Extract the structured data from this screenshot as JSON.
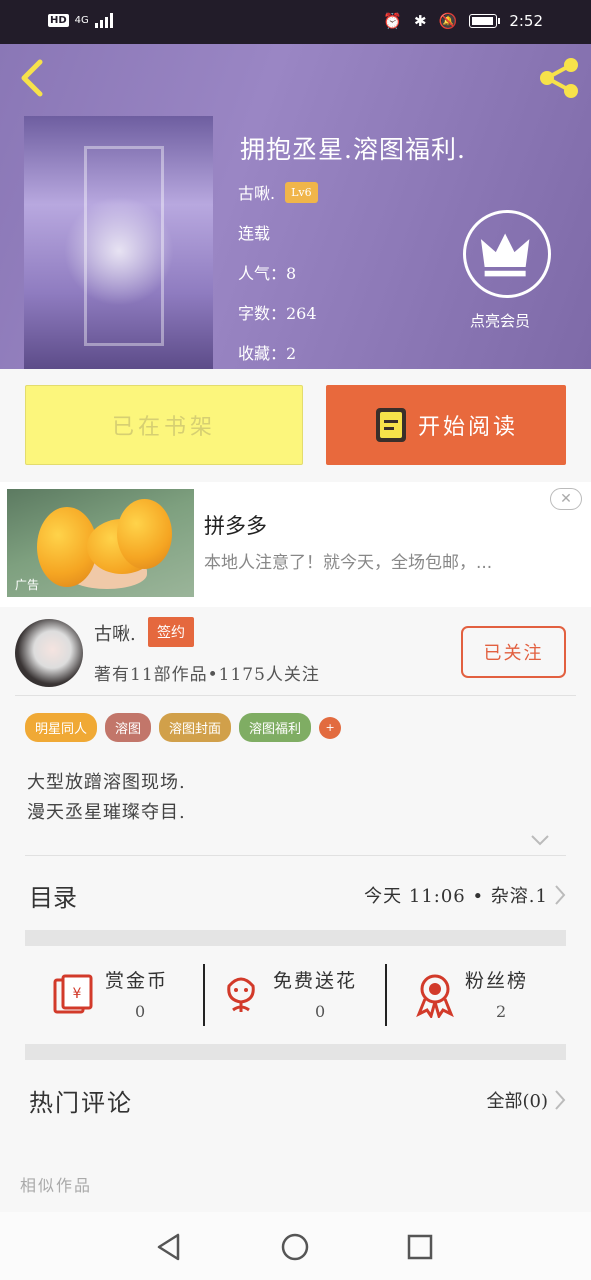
{
  "status_bar": {
    "network_hd": "HD",
    "network_type": "4G",
    "time": "2:52"
  },
  "book": {
    "title": "拥抱丞星.溶图福利.",
    "author": "古啾.",
    "level": "Lv6",
    "status": "连载",
    "popularity": "人气：8",
    "word_count": "字数：264",
    "favorites": "收藏：2",
    "vip_label": "点亮会员"
  },
  "actions_top": {
    "shelf_label": "已在书架",
    "read_label": "开始阅读"
  },
  "ad": {
    "title": "拼多多",
    "description": "本地人注意了！就今天，全场包邮，...",
    "tag": "广告",
    "close": "✕"
  },
  "author_card": {
    "name": "古啾.",
    "signed": "签约",
    "stats": "著有11部作品•1175人关注",
    "follow_label": "已关注"
  },
  "tags": [
    {
      "label": "明星同人",
      "color": "#f0a935"
    },
    {
      "label": "溶图",
      "color": "#c2766a"
    },
    {
      "label": "溶图封面",
      "color": "#d1a04a"
    },
    {
      "label": "溶图福利",
      "color": "#7fad63"
    }
  ],
  "tag_more": "+",
  "synopsis": {
    "line1": "大型放蹭溶图现场.",
    "line2": "漫天丞星璀璨夺目."
  },
  "catalog": {
    "label": "目录",
    "info": "今天 11:06 • 杂溶.1"
  },
  "stats_row": [
    {
      "label": "赏金币",
      "value": "0",
      "icon": "red-envelope-icon"
    },
    {
      "label": "免费送花",
      "value": "0",
      "icon": "flower-icon"
    },
    {
      "label": "粉丝榜",
      "value": "2",
      "icon": "award-ribbon-icon"
    }
  ],
  "comments": {
    "label": "热门评论",
    "all": "全部(0)"
  },
  "similar_label": "相似作品",
  "colors": {
    "accent": "#e8693d",
    "shelf_yellow": "#fcf67c",
    "header_purple": "#8a77b6"
  }
}
